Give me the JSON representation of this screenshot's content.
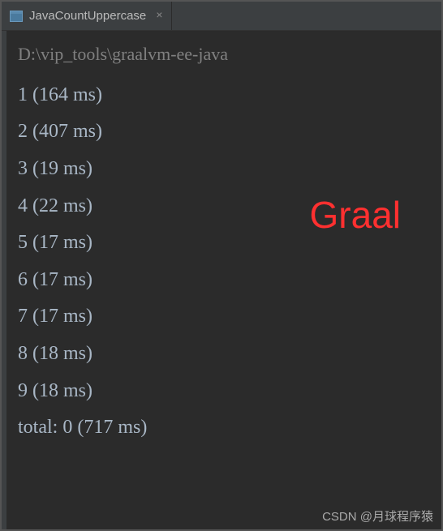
{
  "tab": {
    "label": "JavaCountUppercase",
    "close": "×"
  },
  "console": {
    "path": "D:\\vip_tools\\graalvm-ee-java",
    "lines": [
      "1 (164 ms)",
      "2 (407 ms)",
      "3 (19 ms)",
      "4 (22 ms)",
      "5 (17 ms)",
      "6 (17 ms)",
      "7 (17 ms)",
      "8 (18 ms)",
      "9 (18 ms)",
      "total: 0 (717 ms)"
    ]
  },
  "annotation": "Graal",
  "watermark": "CSDN @月球程序猿"
}
